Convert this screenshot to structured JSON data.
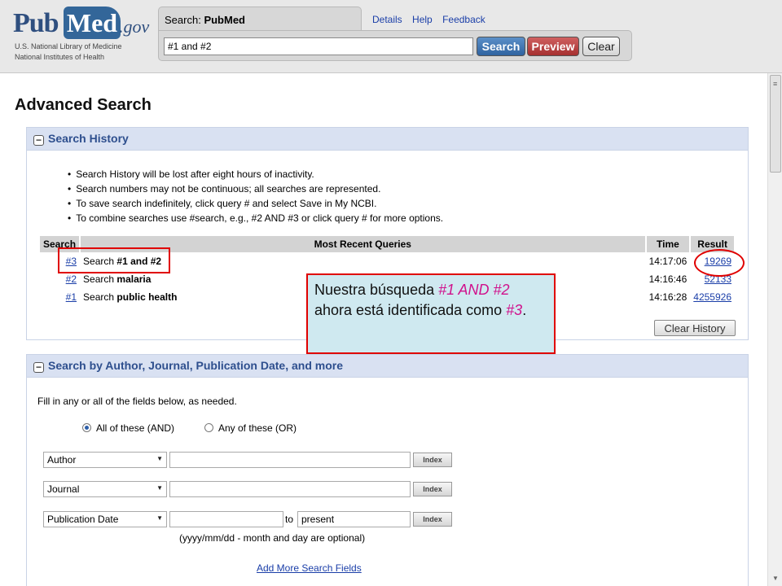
{
  "header": {
    "logo": {
      "pub": "Pub",
      "med": "Med",
      "gov": ".gov",
      "line1": "U.S. National Library of Medicine",
      "line2": "National Institutes of Health"
    },
    "search_tab_prefix": "Search:",
    "search_tab_db": "PubMed",
    "search_value": "#1 and #2",
    "links": [
      "Details",
      "Help",
      "Feedback"
    ],
    "buttons": {
      "search": "Search",
      "preview": "Preview",
      "clear": "Clear"
    }
  },
  "page_title": "Advanced Search",
  "history": {
    "heading": "Search History",
    "notes": [
      "Search History will be lost after eight hours of inactivity.",
      "Search numbers may not be continuous; all searches are represented.",
      "To save search indefinitely, click query # and select Save in My NCBI.",
      "To combine searches use #search, e.g., #2 AND #3 or click query # for more options."
    ],
    "columns": {
      "search": "Search",
      "query": "Most Recent Queries",
      "time": "Time",
      "result": "Result"
    },
    "rows": [
      {
        "num": "#3",
        "prefix": "Search",
        "term": "#1 and #2",
        "time": "14:17:06",
        "result": "19269"
      },
      {
        "num": "#2",
        "prefix": "Search",
        "term": "malaria",
        "time": "14:16:46",
        "result": "52133"
      },
      {
        "num": "#1",
        "prefix": "Search",
        "term": "public health",
        "time": "14:16:28",
        "result": "4255926"
      }
    ],
    "clear_history": "Clear History"
  },
  "author_section": {
    "heading": "Search by Author, Journal, Publication Date, and more",
    "instructions": "Fill in any or all of the fields below, as needed.",
    "radio_and": "All of these (AND)",
    "radio_or": "Any of these (OR)",
    "fields": [
      {
        "select": "Author",
        "index": "Index"
      },
      {
        "select": "Journal",
        "index": "Index"
      },
      {
        "select": "Publication Date",
        "index": "Index"
      }
    ],
    "date_to_label": "to",
    "date_to_value": "present",
    "date_hint": "(yyyy/mm/dd - month and day are optional)",
    "add_more": "Add More Search Fields"
  },
  "callout": {
    "part1": "Nuestra búsqueda",
    "hl1": "#1 AND #2",
    "part2": "ahora está identificada como",
    "hl2": "#3",
    "end": "."
  },
  "colors": {
    "accent": "#336699",
    "annotation": "#e00000",
    "callout_bg": "#cfe9f0",
    "highlight": "#d0118c"
  }
}
